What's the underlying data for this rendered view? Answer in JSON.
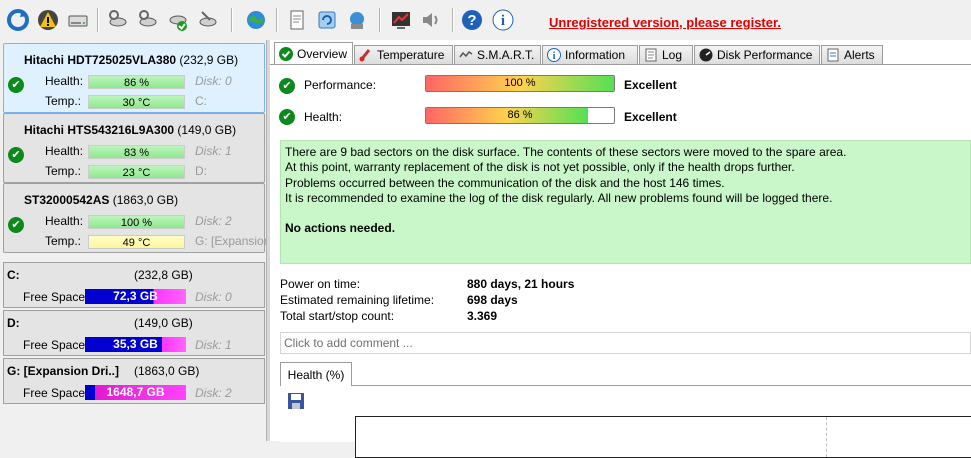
{
  "toolbar": {
    "icons": [
      "refresh-icon",
      "warning-icon",
      "drive-icon",
      "disk-settings-icon",
      "disk-settings-2-icon",
      "disk-ok-icon",
      "disk-tools-icon",
      "globe-icon",
      "report-icon",
      "sync-icon",
      "network-icon",
      "chart-icon",
      "speaker-icon",
      "help-icon",
      "info-icon"
    ],
    "unregistered_text": "Unregistered version, please register."
  },
  "disks": [
    {
      "name": "Hitachi HDT725025VLA380",
      "size": "(232,9 GB)",
      "health_label": "Health:",
      "health": "86 %",
      "health_pct": 86,
      "disk_no": "Disk: 0",
      "temp_label": "Temp.:",
      "temp": "30 °C",
      "drive": "C:",
      "temp_warn": false
    },
    {
      "name": "Hitachi HTS543216L9A300",
      "size": "(149,0 GB)",
      "health_label": "Health:",
      "health": "83 %",
      "health_pct": 83,
      "disk_no": "Disk: 1",
      "temp_label": "Temp.:",
      "temp": "23 °C",
      "drive": "D:",
      "temp_warn": false
    },
    {
      "name": "ST32000542AS",
      "size": "(1863,0 GB)",
      "health_label": "Health:",
      "health": "100 %",
      "health_pct": 100,
      "disk_no": "Disk: 2",
      "temp_label": "Temp.:",
      "temp": "49 °C",
      "drive": "G: [Expansion",
      "temp_warn": true
    }
  ],
  "volumes": [
    {
      "name": "C:",
      "size": "(232,8 GB)",
      "free_label": "Free Space",
      "free": "72,3 GB",
      "disk_no": "Disk: 0"
    },
    {
      "name": "D:",
      "size": "(149,0 GB)",
      "free_label": "Free Space",
      "free": "35,3 GB",
      "disk_no": "Disk: 1"
    },
    {
      "name": "G: [Expansion Dri..]",
      "size": "(1863,0 GB)",
      "free_label": "Free Space",
      "free": "1648,7 GB",
      "disk_no": "Disk: 2"
    }
  ],
  "tabs": [
    "Overview",
    "Temperature",
    "S.M.A.R.T.",
    "Information",
    "Log",
    "Disk Performance",
    "Alerts"
  ],
  "overview": {
    "performance_label": "Performance:",
    "performance": "100 %",
    "performance_pct": 100,
    "performance_rating": "Excellent",
    "health_label": "Health:",
    "health": "86 %",
    "health_pct": 86,
    "health_rating": "Excellent",
    "message": [
      "There are 9 bad sectors on the disk surface. The contents of these sectors were moved to the spare area.",
      "At this point, warranty replacement of the disk is not yet possible, only if the health drops further.",
      "Problems occurred between the communication of the disk and the host 146 times.",
      "It is recommended to examine the log of the disk regularly. All new problems found will be logged there."
    ],
    "action": "No actions needed.",
    "stats": [
      {
        "label": "Power on time:",
        "value": "880 days, 21 hours"
      },
      {
        "label": "Estimated remaining lifetime:",
        "value": "698 days"
      },
      {
        "label": "Total start/stop count:",
        "value": "3.369"
      }
    ],
    "comment_placeholder": "Click to add comment ...",
    "graph_tab": "Health (%)"
  }
}
